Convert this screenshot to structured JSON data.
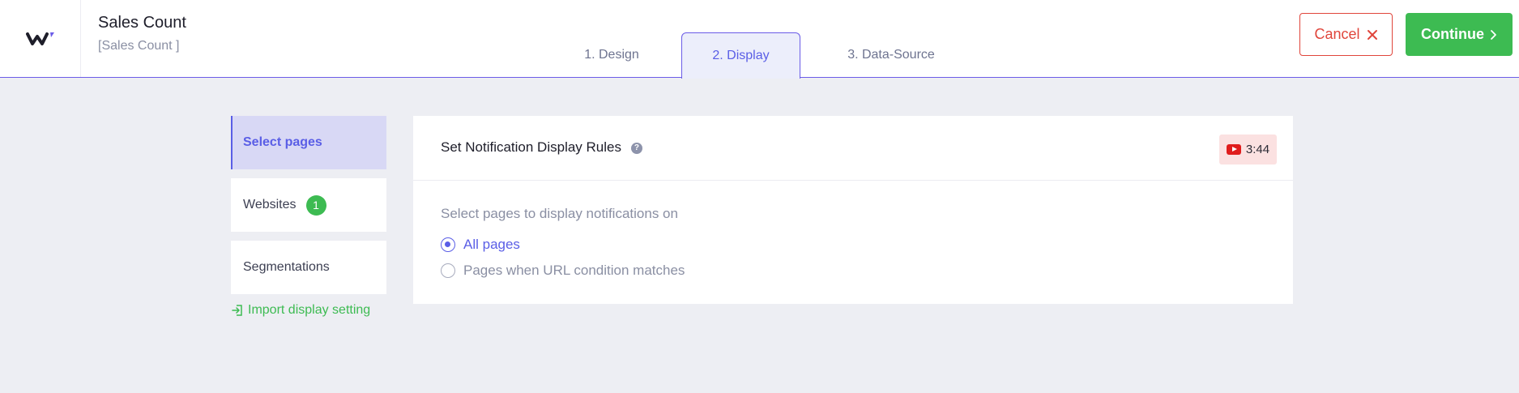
{
  "header": {
    "title": "Sales Count",
    "subtitle": "[Sales Count ]",
    "logo_icon": "w-logo-icon"
  },
  "tabs": [
    {
      "label": "1. Design",
      "active": false
    },
    {
      "label": "2. Display",
      "active": true
    },
    {
      "label": "3. Data-Source",
      "active": false
    }
  ],
  "actions": {
    "cancel_label": "Cancel",
    "continue_label": "Continue"
  },
  "sidebar": {
    "items": [
      {
        "label": "Select pages",
        "active": true
      },
      {
        "label": "Websites",
        "badge": "1"
      },
      {
        "label": "Segmentations"
      }
    ],
    "import_label": "Import display setting"
  },
  "panel": {
    "title": "Set Notification Display Rules",
    "help_glyph": "?",
    "video_duration": "3:44",
    "section_label": "Select pages to display notifications on",
    "options": [
      {
        "label": "All pages",
        "selected": true
      },
      {
        "label": "Pages when URL condition matches",
        "selected": false
      }
    ]
  },
  "colors": {
    "accent": "#5a5ee6",
    "success": "#3dbb52",
    "danger": "#e0453b",
    "background": "#edeef3"
  }
}
